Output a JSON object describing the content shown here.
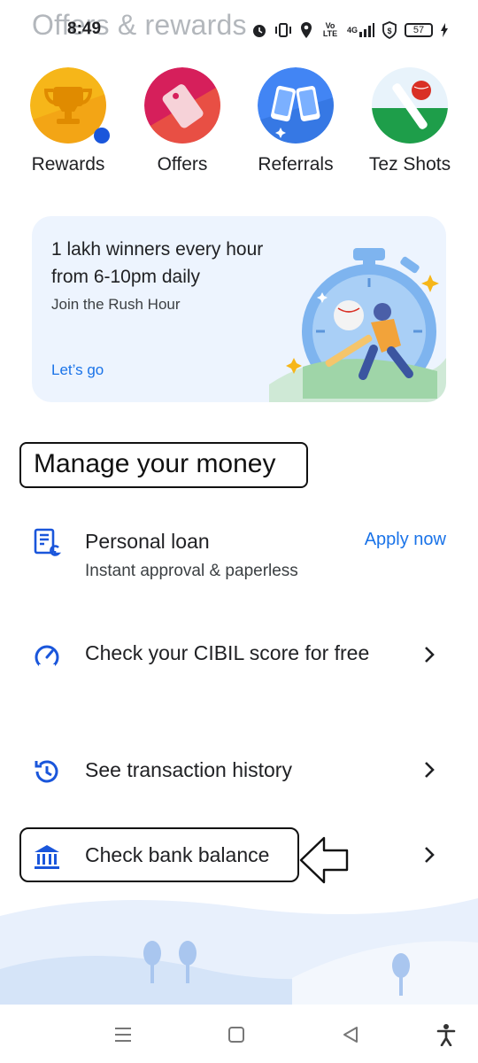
{
  "header": {
    "title": "Offers & rewards"
  },
  "status_bar": {
    "time": "8:49",
    "network_label": "Vo LTE",
    "signal_label": "4G",
    "battery": "57"
  },
  "quick_actions": [
    {
      "label": "Rewards",
      "icon": "trophy-icon",
      "has_notification": true
    },
    {
      "label": "Offers",
      "icon": "tag-icon",
      "has_notification": false
    },
    {
      "label": "Referrals",
      "icon": "phones-icon",
      "has_notification": false
    },
    {
      "label": "Tez Shots",
      "icon": "cricket-bat-icon",
      "has_notification": false
    }
  ],
  "promo": {
    "title": "1 lakh winners every hour from 6-10pm daily",
    "subtitle": "Join the Rush Hour",
    "cta": "Let’s go"
  },
  "manage_money": {
    "heading": "Manage your money",
    "items": [
      {
        "title": "Personal loan",
        "subtitle": "Instant approval & paperless",
        "cta": "Apply now",
        "icon": "loan-document-icon"
      },
      {
        "title": "Check your CIBIL score for free",
        "icon": "gauge-icon"
      },
      {
        "title": "See transaction history",
        "icon": "history-icon"
      },
      {
        "title": "Check bank balance",
        "icon": "bank-icon"
      }
    ]
  },
  "colors": {
    "accent": "#1a73e8",
    "promo_background": "#edf4fe",
    "notification_dot": "#1a56db"
  }
}
